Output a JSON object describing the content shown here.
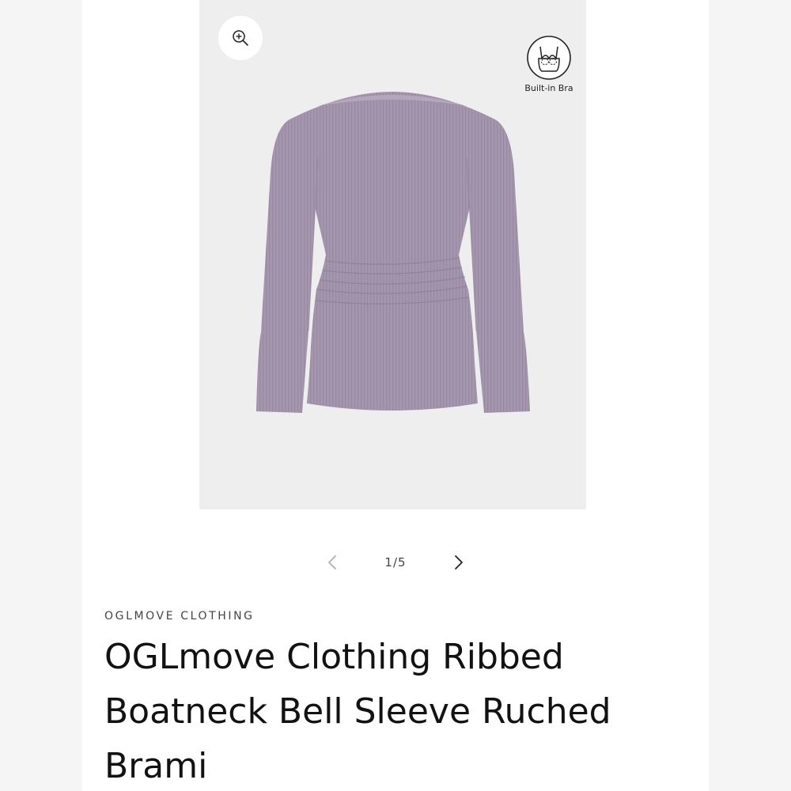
{
  "gallery": {
    "badge_label": "Built-in Bra",
    "product_color": "#a596ae",
    "counter": "1/5",
    "current_index": 1,
    "total": 5
  },
  "product": {
    "vendor": "OGLMOVE CLOTHING",
    "title": "OGLmove Clothing Ribbed Boatneck Bell Sleeve Ruched Brami"
  },
  "icons": {
    "zoom": "zoom-in-icon",
    "bra": "bra-icon",
    "prev": "chevron-left-icon",
    "next": "chevron-right-icon"
  }
}
